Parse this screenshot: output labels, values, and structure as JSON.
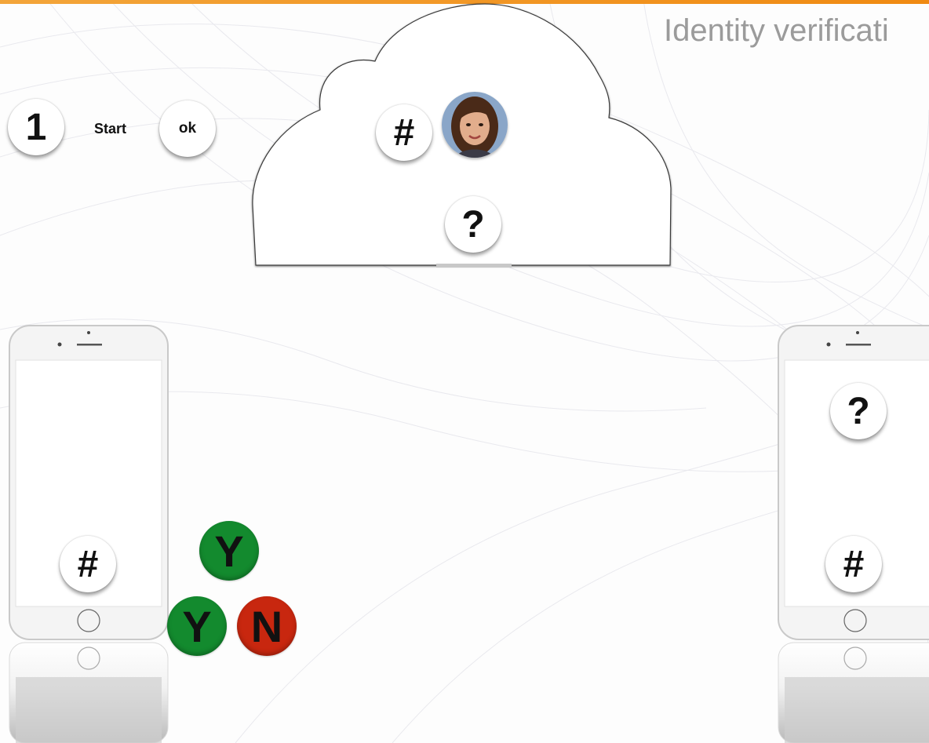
{
  "title": "Identity verificati",
  "steps": {
    "number": "1",
    "start_label": "Start",
    "ok_label": "ok"
  },
  "cloud": {
    "hash_symbol": "#",
    "question_symbol": "?"
  },
  "left_phone": {
    "hash_symbol": "#"
  },
  "right_phone": {
    "question_symbol": "?",
    "hash_symbol": "#"
  },
  "votes": [
    {
      "label": "Y",
      "color": "#138a2e"
    },
    {
      "label": "Y",
      "color": "#138a2e"
    },
    {
      "label": "N",
      "color": "#c8270f"
    }
  ],
  "colors": {
    "accent": "#f08a12",
    "title": "#9b9b9b",
    "yes": "#138a2e",
    "no": "#c8270f"
  },
  "icons": {
    "avatar": "person-photo-icon",
    "cloud": "cloud-icon",
    "phone": "smartphone-icon"
  }
}
